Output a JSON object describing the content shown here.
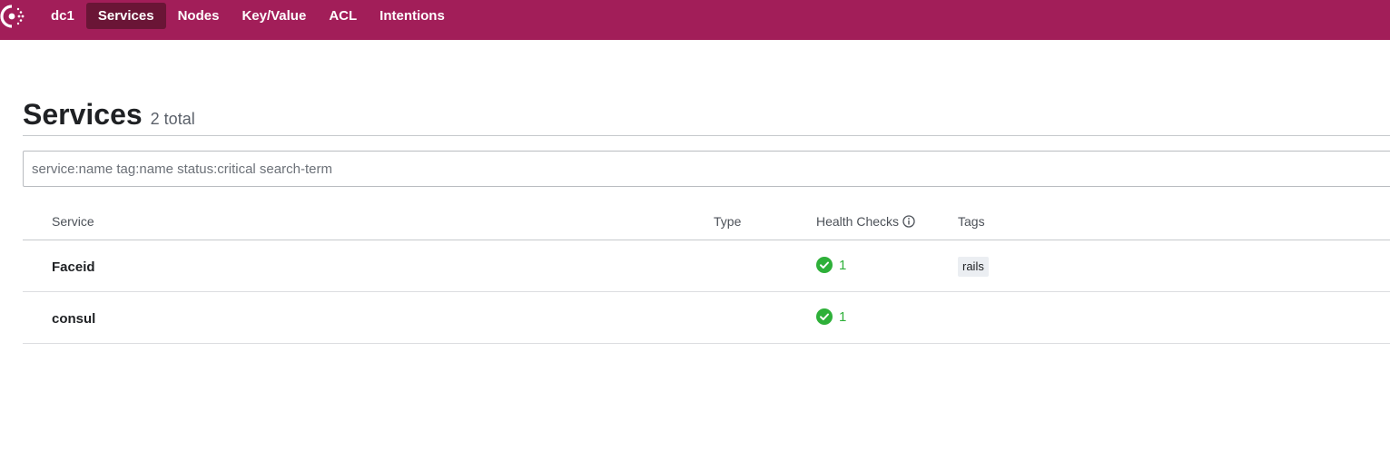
{
  "nav": {
    "datacenter": "dc1",
    "items": [
      {
        "label": "Services",
        "active": true
      },
      {
        "label": "Nodes",
        "active": false
      },
      {
        "label": "Key/Value",
        "active": false
      },
      {
        "label": "ACL",
        "active": false
      },
      {
        "label": "Intentions",
        "active": false
      }
    ]
  },
  "page": {
    "title": "Services",
    "total": "2 total"
  },
  "search": {
    "placeholder": "service:name tag:name status:critical search-term",
    "value": ""
  },
  "table": {
    "columns": [
      "Service",
      "Type",
      "Health Checks",
      "Tags"
    ],
    "rows": [
      {
        "name": "Faceid",
        "type": "",
        "health_passing": "1",
        "tags": [
          "rails"
        ]
      },
      {
        "name": "consul",
        "type": "",
        "health_passing": "1",
        "tags": []
      }
    ]
  },
  "colors": {
    "brand": "#a21e59",
    "nav_active": "#6a1536",
    "passing": "#2eb039"
  },
  "icons": {
    "logo": "consul-logo-icon",
    "info": "info-icon",
    "check": "check-circle-icon"
  }
}
